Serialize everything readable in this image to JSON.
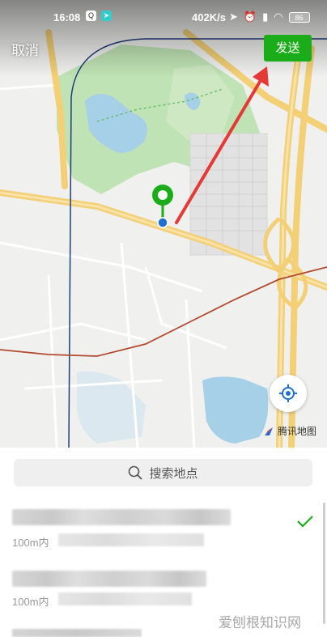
{
  "status_bar": {
    "time": "16:08",
    "network_speed": "402K/s",
    "battery": "86",
    "icons": [
      "qq-icon",
      "send-icon",
      "location-arrow-icon",
      "alarm-icon",
      "signal-icon",
      "wifi-icon",
      "battery-icon"
    ]
  },
  "header": {
    "cancel_label": "取消",
    "send_label": "发送"
  },
  "map": {
    "provider_label": "腾讯地图",
    "accent_color": "#1aad19"
  },
  "search": {
    "placeholder": "搜索地点"
  },
  "results": [
    {
      "distance": "100m内",
      "selected": true
    },
    {
      "distance": "100m内",
      "selected": false
    }
  ],
  "watermark": "爱刨根知识网"
}
